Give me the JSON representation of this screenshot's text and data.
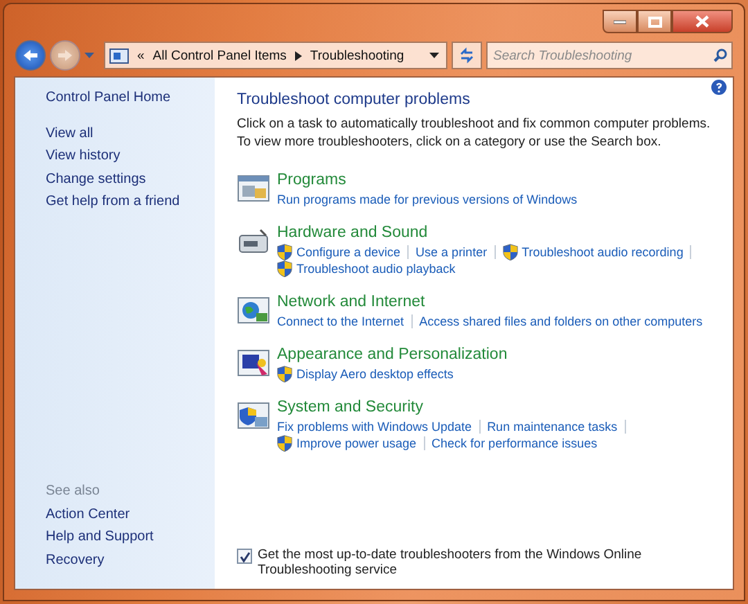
{
  "window": {
    "controls": [
      {
        "kind": "minimize"
      },
      {
        "kind": "maximize"
      },
      {
        "kind": "close"
      }
    ]
  },
  "address_bar": {
    "overflow": "«",
    "path": [
      "All Control Panel Items",
      "Troubleshooting"
    ]
  },
  "search": {
    "placeholder": "Search Troubleshooting"
  },
  "sidebar": {
    "home": "Control Panel Home",
    "items": [
      "View all",
      "View history",
      "Change settings",
      "Get help from a friend"
    ],
    "see_also_title": "See also",
    "see_also": [
      "Action Center",
      "Help and Support",
      "Recovery"
    ]
  },
  "main": {
    "title": "Troubleshoot computer problems",
    "description": "Click on a task to automatically troubleshoot and fix common computer problems. To view more troubleshooters, click on a category or use the Search box.",
    "categories": [
      {
        "kind": "programs",
        "title": "Programs",
        "lines": [
          [
            {
              "label": "Run programs made for previous versions of Windows",
              "shield": false
            }
          ]
        ]
      },
      {
        "kind": "hardware",
        "title": "Hardware and Sound",
        "lines": [
          [
            {
              "label": "Configure a device",
              "shield": true
            },
            {
              "label": "Use a printer",
              "shield": false
            },
            {
              "label": "Troubleshoot audio recording",
              "shield": true
            }
          ],
          [
            {
              "label": "Troubleshoot audio playback",
              "shield": true
            }
          ]
        ]
      },
      {
        "kind": "network",
        "title": "Network and Internet",
        "lines": [
          [
            {
              "label": "Connect to the Internet",
              "shield": false
            },
            {
              "label": "Access shared files and folders on other computers",
              "shield": false
            }
          ]
        ]
      },
      {
        "kind": "appearance",
        "title": "Appearance and Personalization",
        "lines": [
          [
            {
              "label": "Display Aero desktop effects",
              "shield": true
            }
          ]
        ]
      },
      {
        "kind": "security",
        "title": "System and Security",
        "lines": [
          [
            {
              "label": "Fix problems with Windows Update",
              "shield": false
            },
            {
              "label": "Run maintenance tasks",
              "shield": false
            }
          ],
          [
            {
              "label": "Improve power usage",
              "shield": true
            },
            {
              "label": "Check for performance issues",
              "shield": false
            }
          ]
        ]
      }
    ],
    "online_option": {
      "label": "Get the most up-to-date troubleshooters from the Windows Online Troubleshooting service",
      "checked": true
    }
  }
}
